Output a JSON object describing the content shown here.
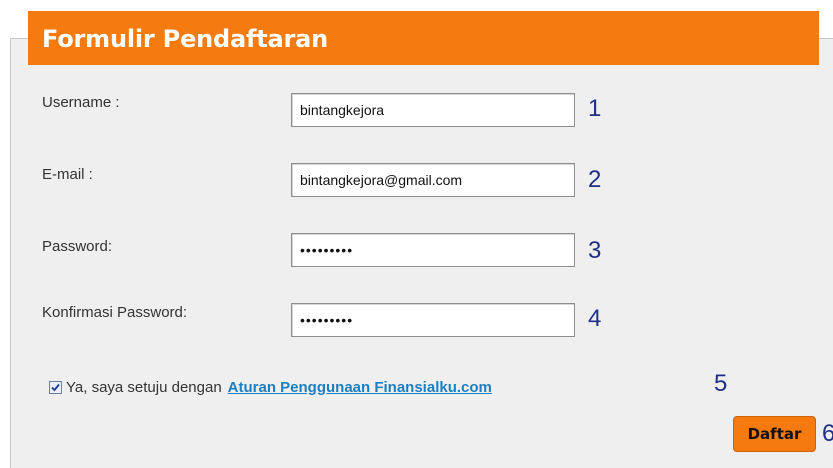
{
  "form": {
    "title": "Formulir Pendaftaran",
    "fields": [
      {
        "label": "Username :",
        "value": "bintangkejora",
        "marker": "1"
      },
      {
        "label": "E-mail :",
        "value": "bintangkejora@gmail.com",
        "marker": "2"
      },
      {
        "label": "Password:",
        "value": "•••••••••",
        "marker": "3"
      },
      {
        "label": "Konfirmasi Password:",
        "value": "•••••••••",
        "marker": "4"
      }
    ],
    "agree": {
      "checked": true,
      "text": "Ya, saya setuju dengan",
      "link_text": "Aturan Penggunaan Finansialku.com",
      "marker": "5"
    },
    "submit": {
      "label": "Daftar",
      "marker": "6"
    }
  },
  "colors": {
    "accent": "#f57a0f",
    "panel_bg": "#efefef",
    "marker": "#1f2f88",
    "link": "#1b7fc4"
  }
}
